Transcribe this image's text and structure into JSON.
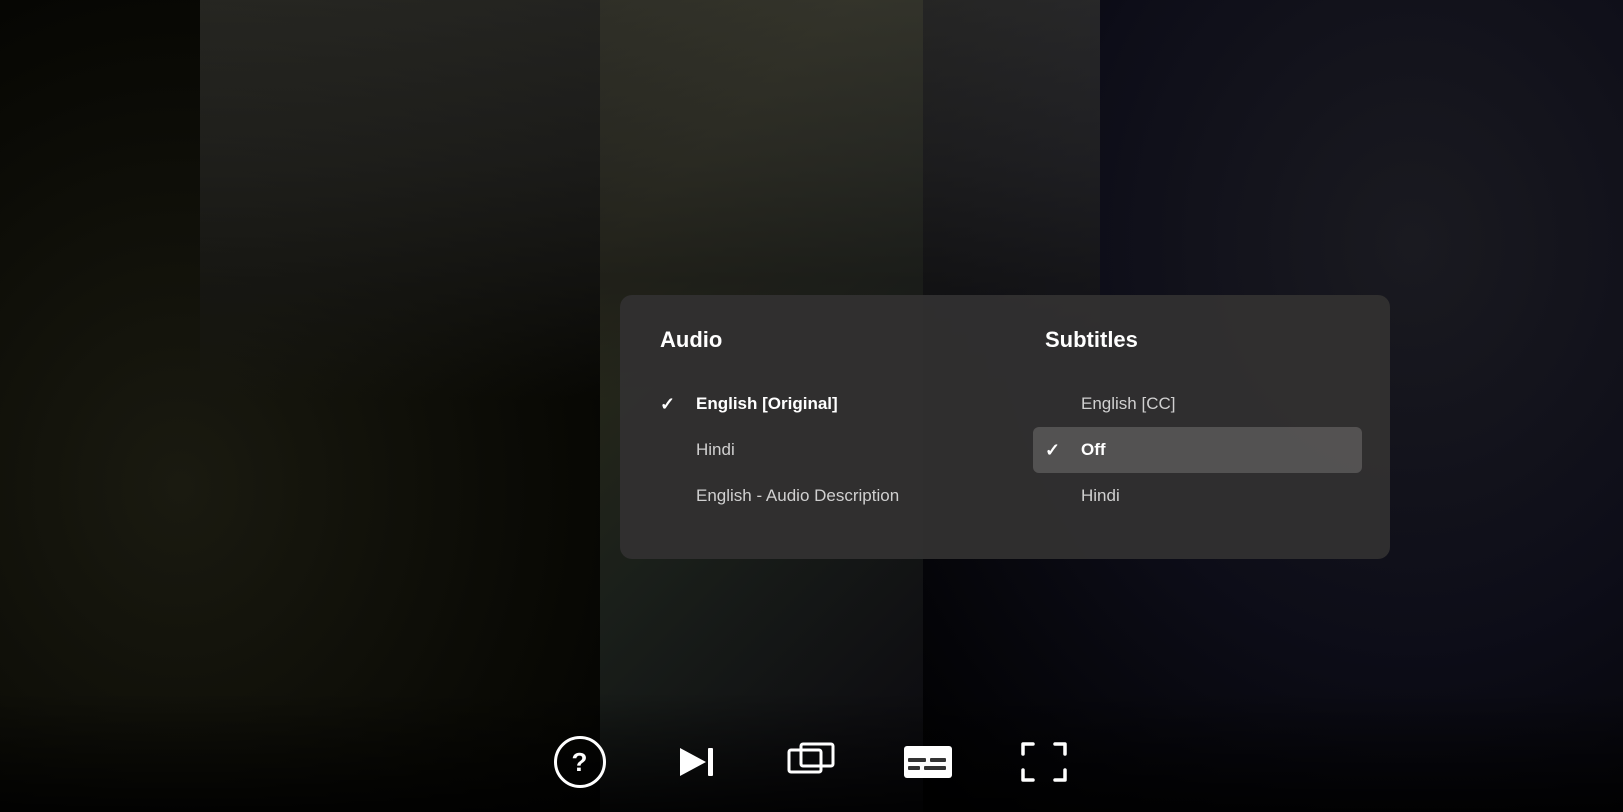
{
  "background": {
    "description": "Dark video player with dimly lit scene"
  },
  "dialog": {
    "audio": {
      "heading": "Audio",
      "options": [
        {
          "label": "English [Original]",
          "selected": true
        },
        {
          "label": "Hindi",
          "selected": false
        },
        {
          "label": "English - Audio Description",
          "selected": false
        }
      ]
    },
    "subtitles": {
      "heading": "Subtitles",
      "options": [
        {
          "label": "English [CC]",
          "selected": false
        },
        {
          "label": "Off",
          "selected": true
        },
        {
          "label": "Hindi",
          "selected": false
        }
      ]
    }
  },
  "controls": {
    "help_label": "?",
    "buttons": [
      "help",
      "skip-next",
      "episodes",
      "subtitles",
      "fullscreen"
    ]
  }
}
